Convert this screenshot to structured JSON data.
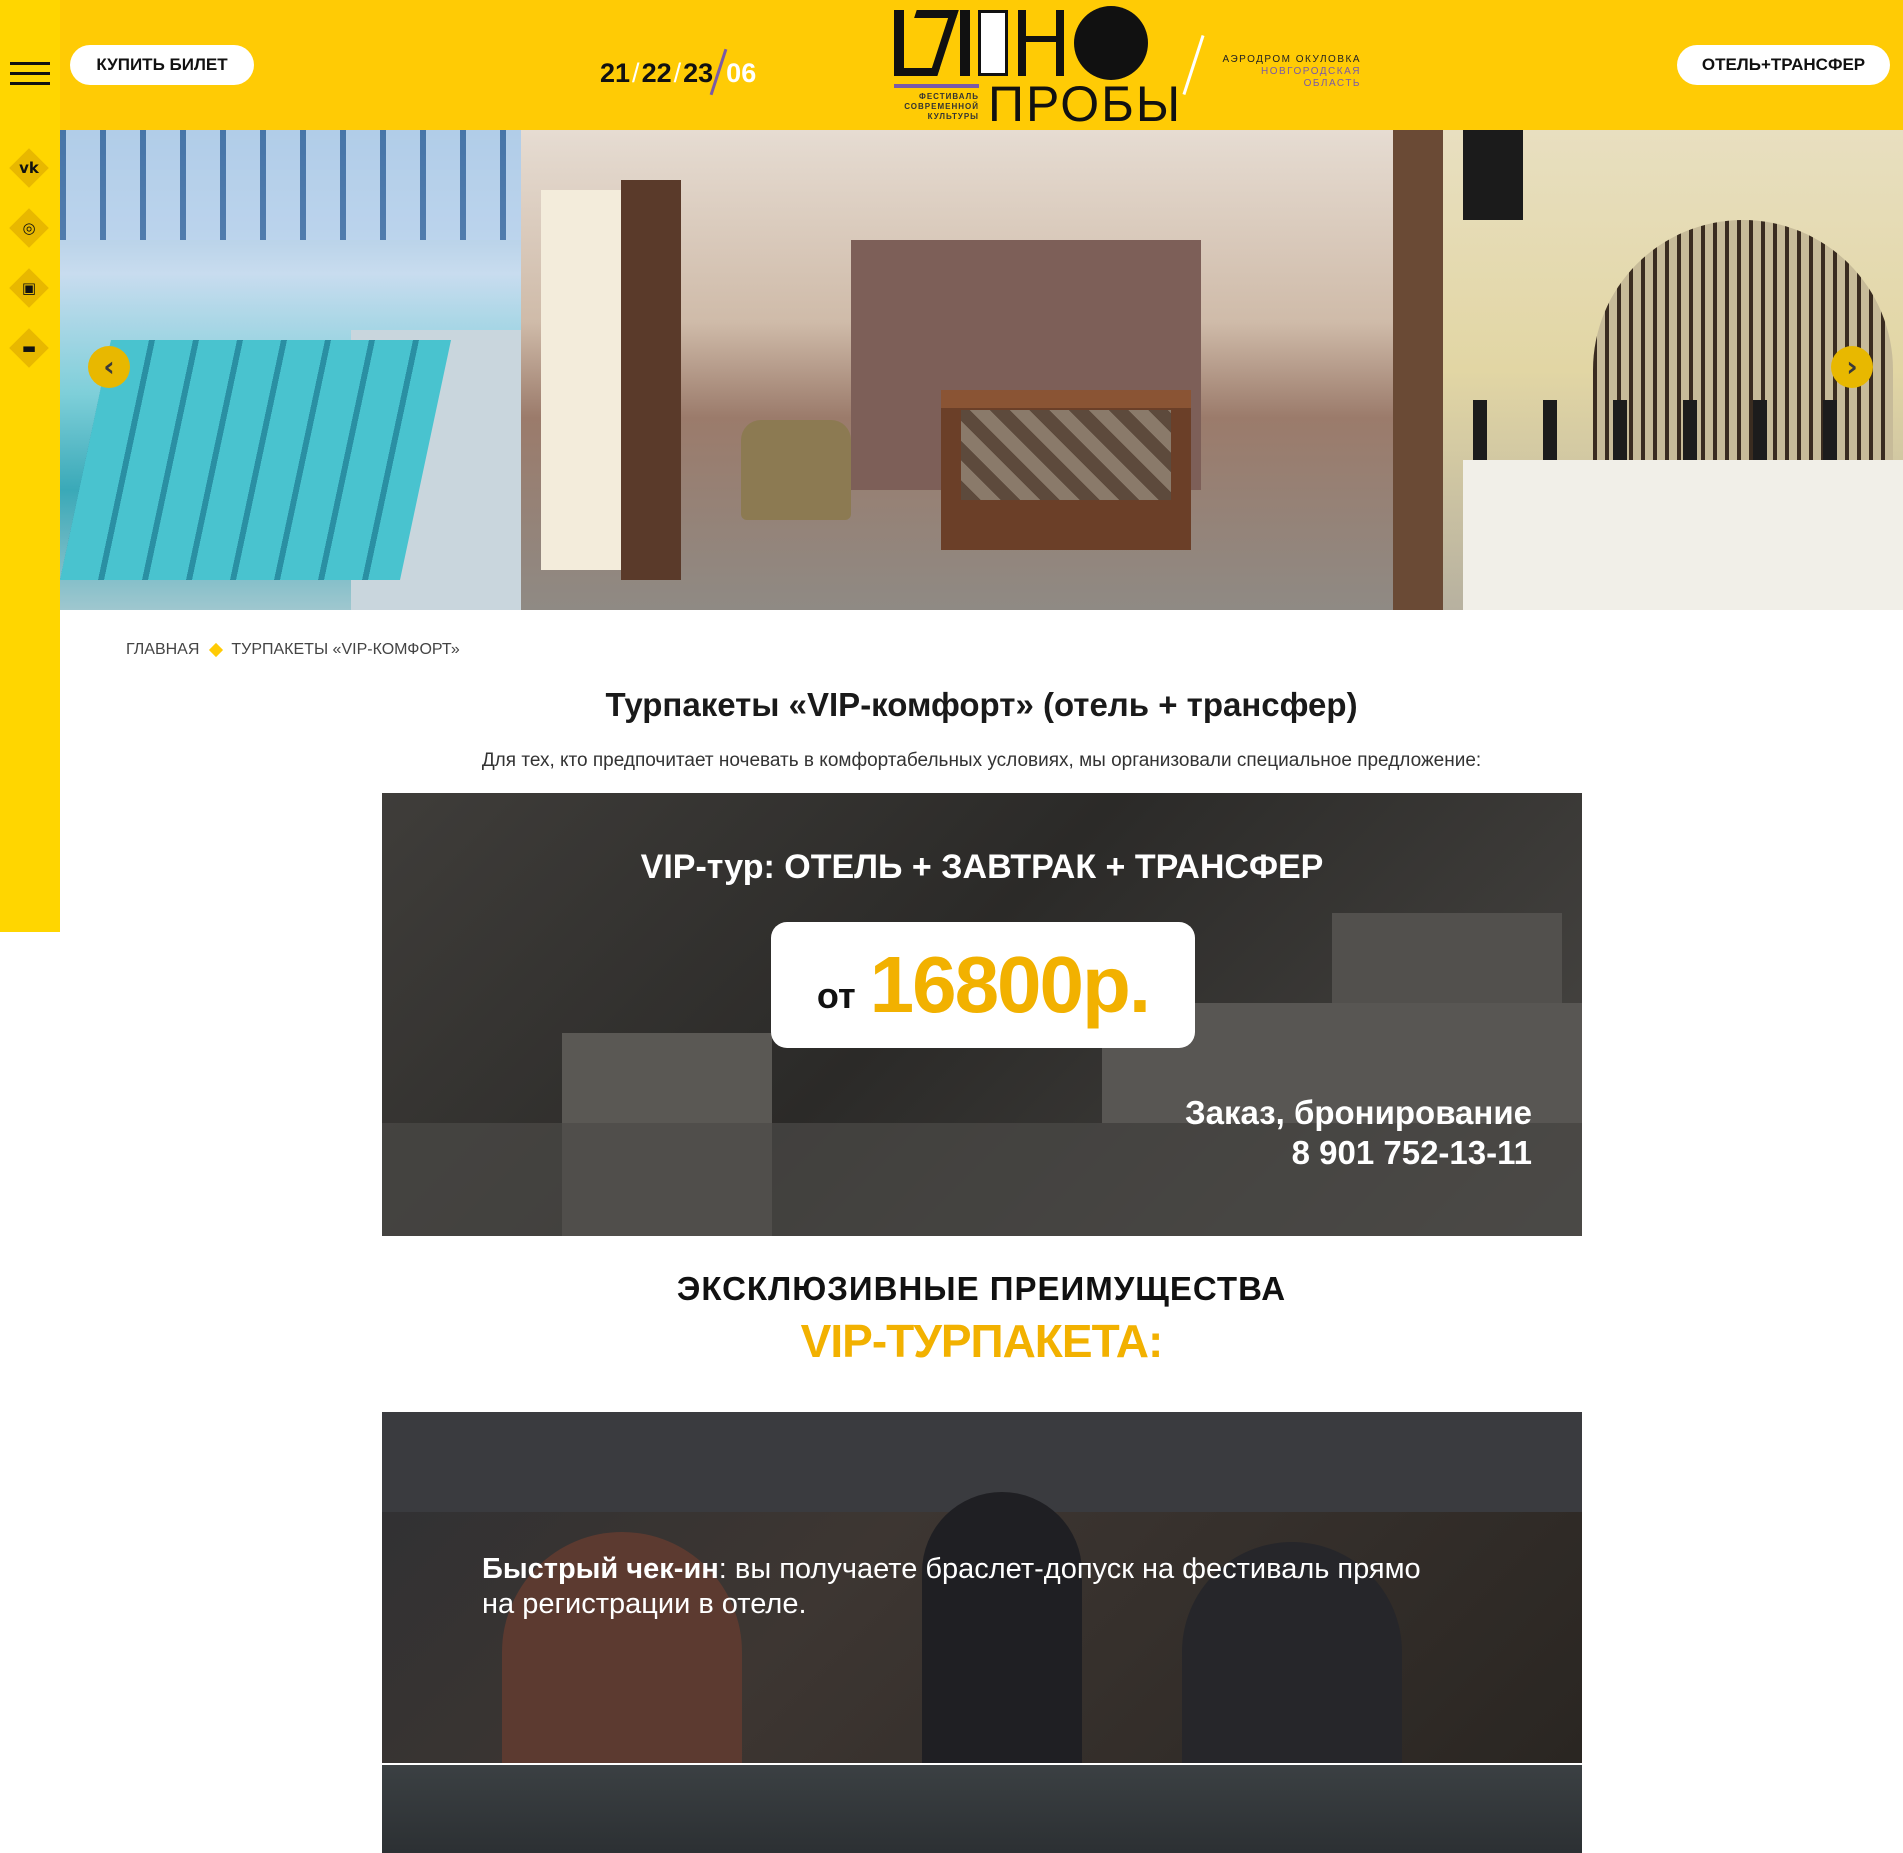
{
  "header": {
    "buy_ticket": "КУПИТЬ БИЛЕТ",
    "hotel_transfer": "ОТЕЛЬ+ТРАНСФЕР",
    "dates": {
      "d1": "21",
      "d2": "22",
      "d3": "23",
      "month": "06"
    },
    "logo": {
      "subtitle_line1": "ФЕСТИВАЛЬ",
      "subtitle_line2": "СОВРЕМЕННОЙ",
      "subtitle_line3": "КУЛЬТУРЫ",
      "word2": "ПРОБЫ"
    },
    "place_line1": "АЭРОДРОМ ОКУЛОВКА",
    "place_line2": "НОВГОРОДСКАЯ ОБЛАСТЬ"
  },
  "sidebar": {
    "socials": [
      {
        "icon": "vk-icon",
        "glyph": "vk"
      },
      {
        "icon": "instagram-icon",
        "glyph": "◎"
      },
      {
        "icon": "ticket-icon",
        "glyph": "▣"
      },
      {
        "icon": "car-icon",
        "glyph": "▬"
      }
    ]
  },
  "slider": {
    "prev": "‹",
    "next": "›"
  },
  "breadcrumb": {
    "home": "ГЛАВНАЯ",
    "current": "ТУРПАКЕТЫ «VIP-КОМФОРТ»"
  },
  "page": {
    "title": "Турпакеты «VIP-комфорт» (отель + трансфер)",
    "intro": "Для тех, кто предпочитает ночевать в комфортабельных условиях, мы организовали специальное предложение:"
  },
  "offer": {
    "title": "VIP-тур: ОТЕЛЬ + ЗАВТРАК + ТРАНСФЕР",
    "price_from": "от",
    "price": "16800р.",
    "contact_label": "Заказ, бронирование",
    "phone": "8 901 752-13-11"
  },
  "advantages": {
    "title": "ЭКСКЛЮЗИВНЫЕ ПРЕИМУЩЕСТВА",
    "subtitle": "VIP-ТУРПАКЕТА:",
    "items": [
      {
        "bold": "Быстрый чек-ин",
        "text": ": вы получаете браслет-допуск на фестиваль прямо на регистрации в отеле."
      }
    ]
  },
  "colors": {
    "brand_yellow": "#ffcb05",
    "accent_gold": "#f2b100",
    "purple": "#7a5aa8"
  }
}
